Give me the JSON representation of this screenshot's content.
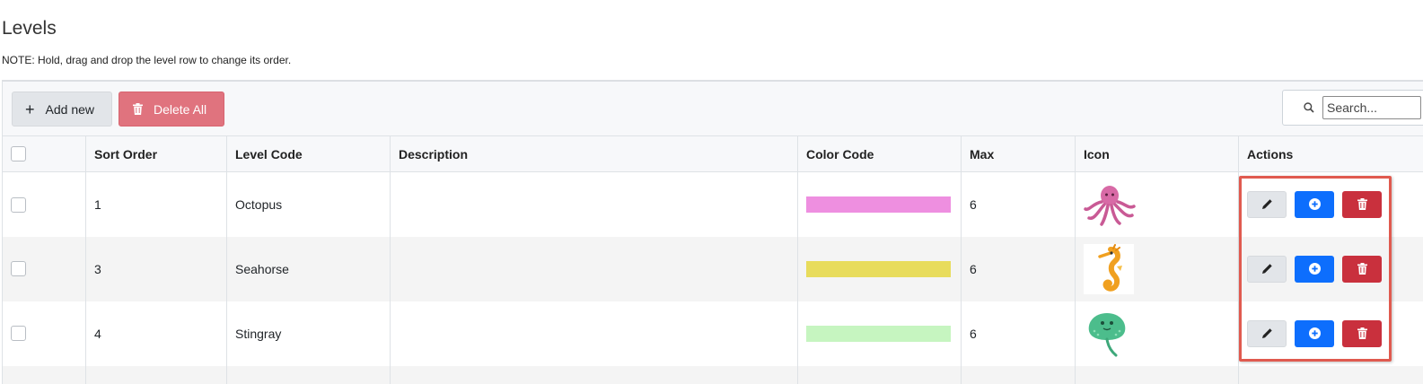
{
  "page": {
    "title": "Levels",
    "note": "NOTE: Hold, drag and drop the level row to change its order."
  },
  "toolbar": {
    "add_new_label": "Add new",
    "delete_all_label": "Delete All",
    "search_placeholder": "Search..."
  },
  "table": {
    "columns": [
      "",
      "Sort Order",
      "Level Code",
      "Description",
      "Color Code",
      "Max",
      "Icon",
      "Actions"
    ],
    "rows": [
      {
        "sort_order": "1",
        "level_code": "Octopus",
        "description": "",
        "color": "#ee8fe0",
        "max": "6",
        "icon": "octopus-icon"
      },
      {
        "sort_order": "3",
        "level_code": "Seahorse",
        "description": "",
        "color": "#e8dc5c",
        "max": "6",
        "icon": "seahorse-icon"
      },
      {
        "sort_order": "4",
        "level_code": "Stingray",
        "description": "",
        "color": "#c6f5c0",
        "max": "6",
        "icon": "stingray-icon"
      }
    ]
  },
  "colors": {
    "add_button": "#0d6efd",
    "delete_button": "#c9303d",
    "delete_all_button": "#e0737e",
    "highlight_border": "#e05a4f"
  }
}
